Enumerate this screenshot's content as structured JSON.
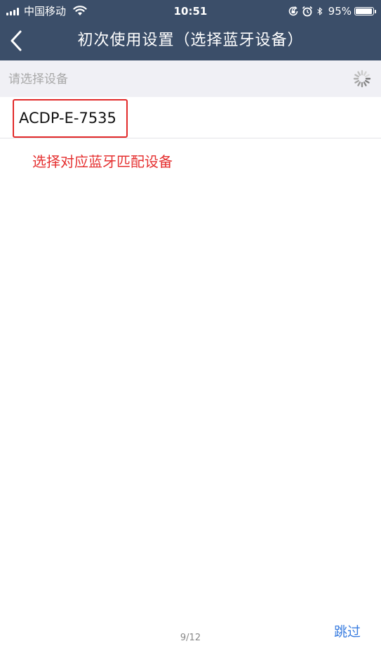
{
  "status_bar": {
    "carrier": "中国移动",
    "time": "10:51",
    "battery_percent": "95%",
    "battery_level": 0.95,
    "icons": [
      "signal-icon",
      "wifi-icon",
      "orientation-lock-icon",
      "alarm-icon",
      "bluetooth-icon",
      "battery-icon"
    ]
  },
  "nav": {
    "title": "初次使用设置（选择蓝牙设备）",
    "back_icon": "chevron-left-icon"
  },
  "device_select": {
    "prompt": "请选择设备",
    "loading_icon": "spinner-icon",
    "devices": [
      {
        "name": "ACDP-E-7535"
      }
    ]
  },
  "annotation": "选择对应蓝牙匹配设备",
  "footer": {
    "page_indicator": "9/12",
    "skip_label": "跳过"
  },
  "colors": {
    "header_bg": "#3b4e69",
    "select_header_bg": "#f0f0f5",
    "highlight_red": "#e22a2a",
    "skip_blue": "#3a7de0"
  }
}
